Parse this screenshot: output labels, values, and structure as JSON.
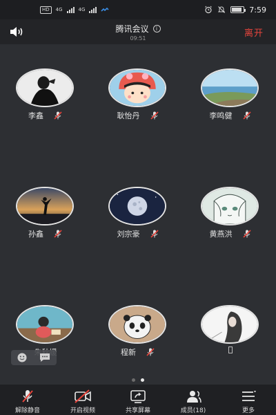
{
  "status_bar": {
    "network_1": "4G",
    "network_2": "4G",
    "time": "7:59",
    "hd": "HD"
  },
  "header": {
    "title": "腾讯会议",
    "duration": "09:51",
    "leave_label": "离开"
  },
  "participants": [
    {
      "name": "李鑫",
      "avatar_icon": "avatar-photo-person",
      "muted": true
    },
    {
      "name": "耿怡丹",
      "avatar_icon": "avatar-cartoon-girl",
      "muted": true
    },
    {
      "name": "李鸣健",
      "avatar_icon": "avatar-photo-seascape",
      "muted": true
    },
    {
      "name": "孙鑫",
      "avatar_icon": "avatar-photo-silhouette-sunset",
      "muted": true
    },
    {
      "name": "刘宗豪",
      "avatar_icon": "avatar-photo-moon",
      "muted": true
    },
    {
      "name": "黄燕洪",
      "avatar_icon": "avatar-anime-sketch",
      "muted": true
    },
    {
      "name": "朱秋媛",
      "avatar_icon": "avatar-photo-child",
      "muted": false
    },
    {
      "name": "程新",
      "avatar_icon": "avatar-cartoon-bear",
      "muted": true
    },
    {
      "name": "",
      "avatar_icon": "avatar-photo-woman-sketch",
      "muted": false
    }
  ],
  "pagination": {
    "pages": 2,
    "current": 2
  },
  "toolbar": {
    "unmute": "解除静音",
    "start_video": "开启视频",
    "share_screen": "共享屏幕",
    "members": "成员(18)",
    "more": "更多"
  },
  "colors": {
    "background": "#2d2f33",
    "leave": "#e8453c",
    "muted_red": "#e8453c",
    "toolbar_bg": "#1f2023"
  }
}
